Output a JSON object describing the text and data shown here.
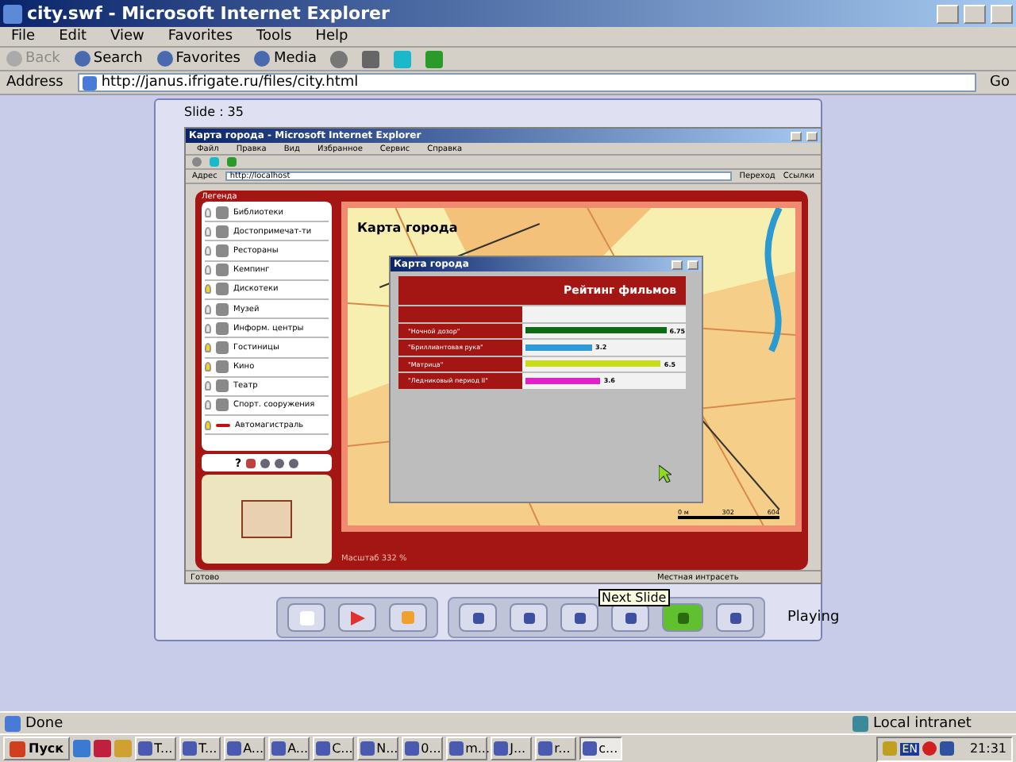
{
  "window": {
    "title": "city.swf - Microsoft Internet Explorer"
  },
  "menu": [
    "File",
    "Edit",
    "View",
    "Favorites",
    "Tools",
    "Help"
  ],
  "toolbar": [
    {
      "label": "Back",
      "disabled": true
    },
    {
      "label": "Search",
      "disabled": false
    },
    {
      "label": "Favorites",
      "disabled": false
    },
    {
      "label": "Media",
      "disabled": false
    }
  ],
  "address": {
    "label": "Address",
    "url": "http://janus.ifrigate.ru/files/city.html",
    "go": "Go"
  },
  "slide": {
    "label": "Slide : 35",
    "inner": {
      "title": "Карта города - Microsoft Internet Explorer",
      "menu": [
        "Файл",
        "Правка",
        "Вид",
        "Избранное",
        "Сервис",
        "Справка"
      ],
      "address_label": "Адрес",
      "url": "http://localhost",
      "go": "Переход",
      "links": "Ссылки",
      "legend_title": "Легенда",
      "legend": [
        {
          "label": "Библиотеки",
          "on": false,
          "kind": "icon"
        },
        {
          "label": "Достопримечат-ти",
          "on": false,
          "kind": "icon"
        },
        {
          "label": "Рестораны",
          "on": false,
          "kind": "icon"
        },
        {
          "label": "Кемпинг",
          "on": false,
          "kind": "icon"
        },
        {
          "label": "Дискотеки",
          "on": true,
          "kind": "icon"
        },
        {
          "label": "Музей",
          "on": false,
          "kind": "icon"
        },
        {
          "label": "Информ. центры",
          "on": false,
          "kind": "icon"
        },
        {
          "label": "Гостиницы",
          "on": true,
          "kind": "icon"
        },
        {
          "label": "Кино",
          "on": true,
          "kind": "icon"
        },
        {
          "label": "Театр",
          "on": false,
          "kind": "icon"
        },
        {
          "label": "Спорт. сооружения",
          "on": false,
          "kind": "icon"
        },
        {
          "label": "Автомагистраль",
          "on": true,
          "kind": "line"
        }
      ],
      "help": "?",
      "map_title": "Карта города",
      "scale_ticks": [
        "0 м",
        "302",
        "604"
      ],
      "scale_text": "Масштаб 332 %",
      "popup": {
        "title": "Карта города",
        "chart_data": {
          "type": "bar",
          "orientation": "horizontal",
          "title": "Рейтинг фильмов",
          "categories": [
            "\"Ночной дозор\"",
            "\"Бриллиантовая рука\"",
            "\"Матрица\"",
            "\"Ледниковый период II\""
          ],
          "series": [
            {
              "color": "#0f6a14",
              "values": [
                6.75,
                null,
                null,
                null
              ]
            },
            {
              "color": "#2f9ad8",
              "values": [
                null,
                3.2,
                null,
                null
              ]
            },
            {
              "color": "#c8dc1c",
              "values": [
                null,
                null,
                6.5,
                null
              ]
            },
            {
              "color": "#e020c8",
              "values": [
                null,
                null,
                null,
                3.6
              ]
            }
          ],
          "stacked": true,
          "xlim": [
            0,
            7
          ],
          "data_labels": true
        }
      },
      "status": "Готово",
      "zone": "Местная интрасеть"
    },
    "player": {
      "tooltip": "Next Slide",
      "state": "Playing"
    }
  },
  "status_bar": {
    "text": "Done",
    "zone": "Local intranet"
  },
  "taskbar": {
    "start": "Пуск",
    "tasks": [
      {
        "label": "T...",
        "selected": false
      },
      {
        "label": "T...",
        "selected": false
      },
      {
        "label": "A...",
        "selected": false
      },
      {
        "label": "A...",
        "selected": false
      },
      {
        "label": "C...",
        "selected": false
      },
      {
        "label": "N...",
        "selected": false
      },
      {
        "label": "0...",
        "selected": false
      },
      {
        "label": "m...",
        "selected": false
      },
      {
        "label": "J...",
        "selected": false
      },
      {
        "label": "r...",
        "selected": false
      },
      {
        "label": "c...",
        "selected": true
      }
    ],
    "lang": "EN",
    "clock": "21:31"
  }
}
